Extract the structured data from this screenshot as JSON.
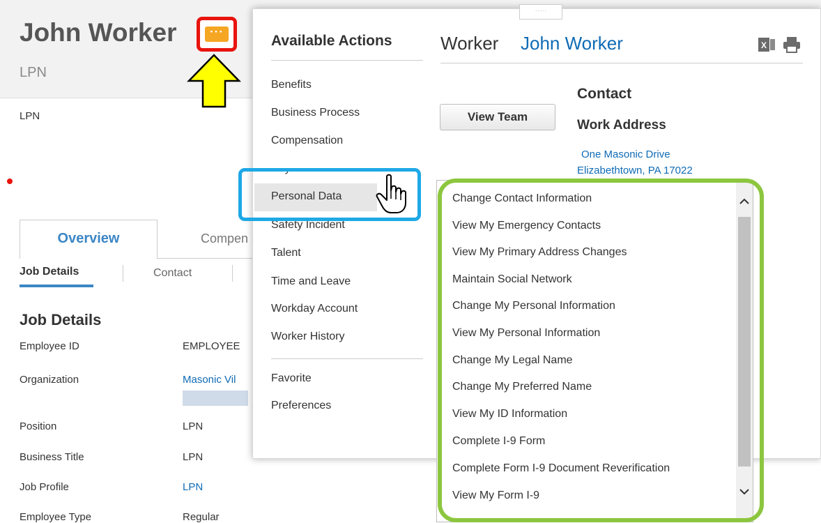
{
  "profile": {
    "name": "John Worker",
    "title": "LPN",
    "body_title": "LPN",
    "related_actions_label": "···",
    "tabs": [
      "Overview",
      "Compen"
    ],
    "subtabs": [
      "Job Details",
      "Contact"
    ],
    "section_heading": "Job Details",
    "fields": [
      {
        "label": "Employee ID",
        "value": "EMPLOYEE"
      },
      {
        "label": "Organization",
        "value": "Masonic Vil"
      },
      {
        "label": "Position",
        "value": "LPN"
      },
      {
        "label": "Business Title",
        "value": "LPN"
      },
      {
        "label": "Job Profile",
        "value": "LPN"
      },
      {
        "label": "Employee Type",
        "value": "Regular"
      }
    ]
  },
  "popup": {
    "grip_label": "·····",
    "actions_heading": "Available Actions",
    "actions": [
      "Benefits",
      "Business Process",
      "Compensation",
      "Payroll",
      "Personal Data",
      "Safety Incident",
      "Talent",
      "Time and Leave",
      "Workday Account",
      "Worker History"
    ],
    "secondary_actions": [
      "Favorite",
      "Preferences"
    ],
    "selected_action": "Personal Data",
    "worker_label": "Worker",
    "worker_name": "John Worker",
    "view_team_label": "View Team",
    "contact_heading": "Contact",
    "work_address_heading": "Work Address",
    "address_line1": "One Masonic Drive",
    "address_line2": "Elizabethtown, PA 17022",
    "background_paren": ")"
  },
  "submenu": {
    "items": [
      "Change Contact Information",
      "View My Emergency Contacts",
      "View My Primary Address Changes",
      "Maintain Social Network",
      "Change My Personal Information",
      "View My Personal Information",
      "Change My Legal Name",
      "Change My Preferred Name",
      "View My ID Information",
      "Complete I-9 Form",
      "Complete Form I-9 Document Reverification",
      "View My Form I-9"
    ]
  },
  "colors": {
    "highlight_red": "#e8140d",
    "highlight_cyan": "#1ea8e6",
    "highlight_green": "#8cc63f",
    "arrow_yellow": "#ffff00",
    "link_blue": "#0f6bb5"
  }
}
